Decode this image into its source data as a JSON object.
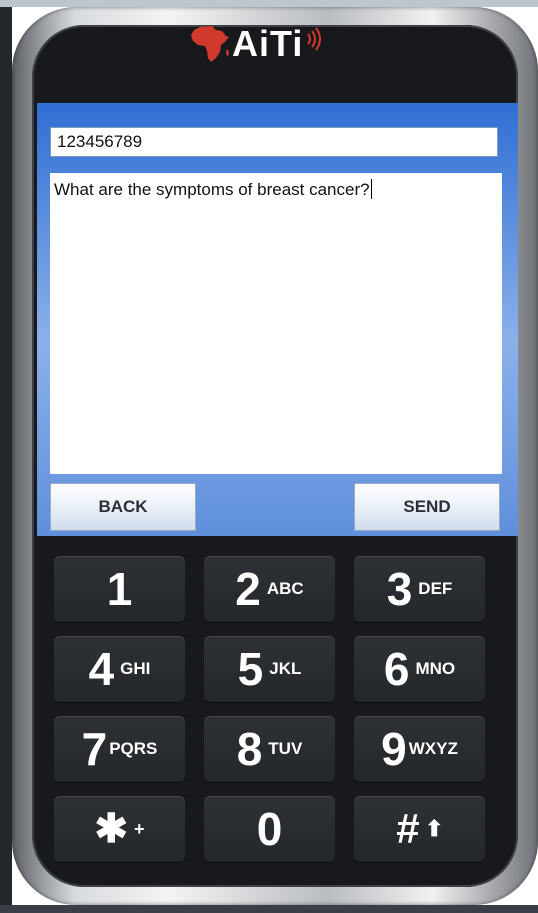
{
  "logo": {
    "text": "AiTi"
  },
  "form": {
    "phone_number": "123456789",
    "message": "What are the symptoms of breast cancer?",
    "back_label": "BACK",
    "send_label": "SEND"
  },
  "keypad": {
    "keys": [
      {
        "digit": "1",
        "letters": ""
      },
      {
        "digit": "2",
        "letters": "ABC"
      },
      {
        "digit": "3",
        "letters": "DEF"
      },
      {
        "digit": "4",
        "letters": "GHI"
      },
      {
        "digit": "5",
        "letters": "JKL"
      },
      {
        "digit": "6",
        "letters": "MNO"
      },
      {
        "digit": "7",
        "letters": "PQRS"
      },
      {
        "digit": "8",
        "letters": "TUV"
      },
      {
        "digit": "9",
        "letters": "WXYZ"
      },
      {
        "digit": "✱",
        "letters": "+"
      },
      {
        "digit": "0",
        "letters": ""
      },
      {
        "digit": "#",
        "letters": "⬆"
      }
    ]
  },
  "colors": {
    "screen_blue": "#2f6ed3",
    "phone_body": "#17191c",
    "africa_red": "#d0392b"
  },
  "icons": [
    "africa-map-icon",
    "signal-waves-icon",
    "shift-up-arrow-icon"
  ]
}
